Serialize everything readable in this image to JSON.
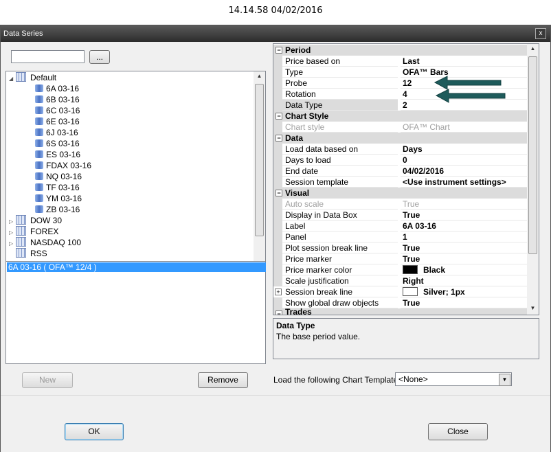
{
  "timestamp": "14.14.58 04/02/2016",
  "window": {
    "title": "Data Series",
    "close": "x"
  },
  "search": {
    "value": "",
    "browse_label": "..."
  },
  "tree": {
    "default_label": "Default",
    "children": [
      "6A 03-16",
      "6B 03-16",
      "6C 03-16",
      "6E 03-16",
      "6J 03-16",
      "6S 03-16",
      "ES 03-16",
      "FDAX 03-16",
      "NQ 03-16",
      "TF 03-16",
      "YM 03-16",
      "ZB 03-16"
    ],
    "groups": [
      "DOW 30",
      "FOREX",
      "NASDAQ 100",
      "RSS"
    ]
  },
  "selected_series": "6A 03-16 ( OFA™ 12/4 )",
  "buttons": {
    "new": "New",
    "remove": "Remove",
    "ok": "OK",
    "close": "Close"
  },
  "properties": {
    "period": {
      "title": "Period",
      "price_based_on": [
        "Price based on",
        "Last"
      ],
      "type": [
        "Type",
        "OFA™ Bars"
      ],
      "probe": [
        "Probe",
        "12"
      ],
      "rotation": [
        "Rotation",
        "4"
      ],
      "data_type": [
        "Data Type",
        "2"
      ]
    },
    "chart_style": {
      "title": "Chart Style",
      "chart_style": [
        "Chart style",
        "OFA™ Chart"
      ]
    },
    "data": {
      "title": "Data",
      "load_based_on": [
        "Load data based on",
        "Days"
      ],
      "days_to_load": [
        "Days to load",
        "0"
      ],
      "end_date": [
        "End date",
        "04/02/2016"
      ],
      "session_template": [
        "Session template",
        "<Use instrument settings>"
      ]
    },
    "visual": {
      "title": "Visual",
      "auto_scale": [
        "Auto scale",
        "True"
      ],
      "display_data_box": [
        "Display in Data Box",
        "True"
      ],
      "label": [
        "Label",
        "6A 03-16"
      ],
      "panel": [
        "Panel",
        "1"
      ],
      "plot_session_break": [
        "Plot session break line",
        "True"
      ],
      "price_marker": [
        "Price marker",
        "True"
      ],
      "price_marker_color": [
        "Price marker color",
        "Black"
      ],
      "scale_justification": [
        "Scale justification",
        "Right"
      ],
      "session_break_line": [
        "Session break line",
        "Silver;  1px"
      ],
      "show_global_draw": [
        "Show global draw objects",
        "True"
      ]
    },
    "trades": {
      "title": "Trades"
    }
  },
  "description": {
    "title": "Data Type",
    "text": "The base period value."
  },
  "template": {
    "label": "Load the following Chart Template:",
    "value": "<None>"
  },
  "colors": {
    "accent_arrow": "#1e5b5b",
    "selection": "#3399ff"
  }
}
